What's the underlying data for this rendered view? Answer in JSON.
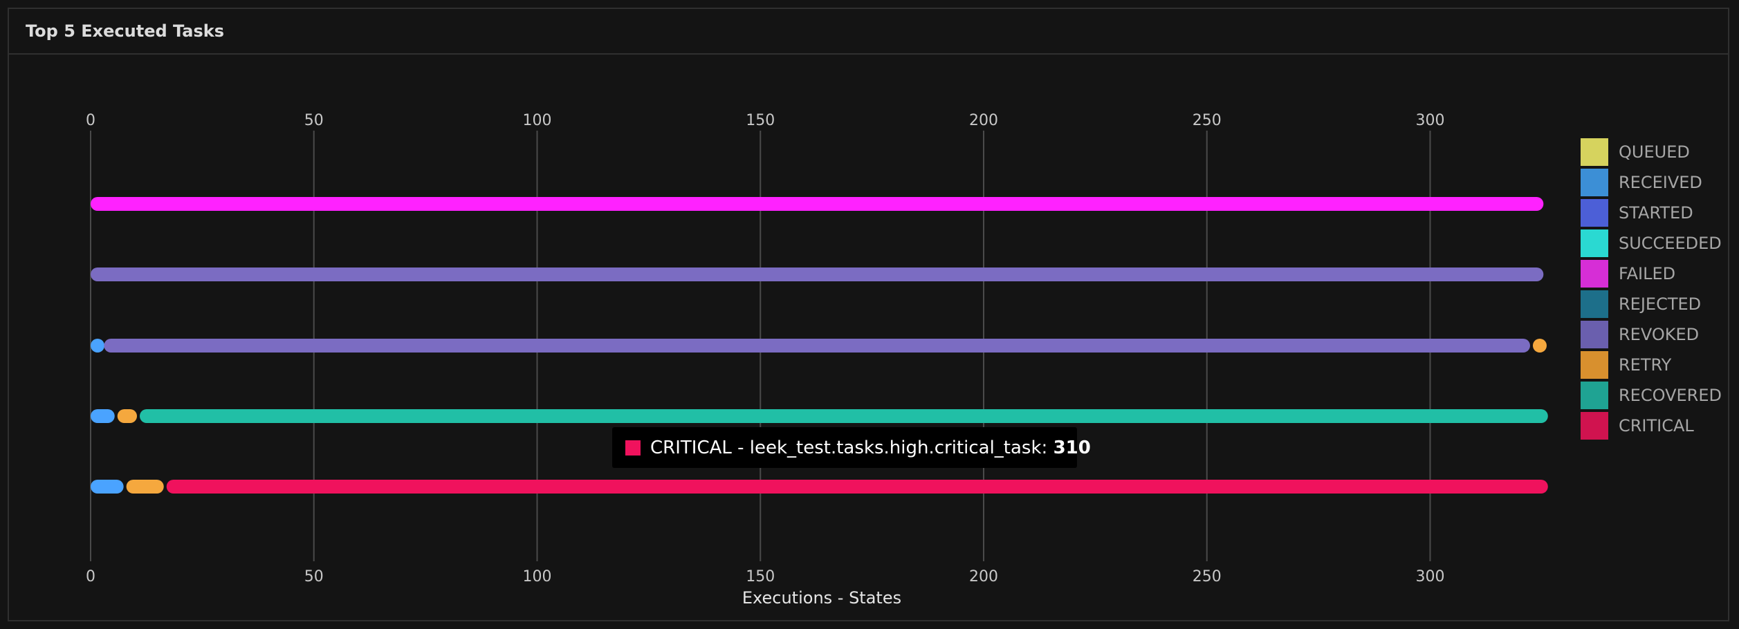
{
  "panel": {
    "title": "Top 5 Executed Tasks"
  },
  "chart_data": {
    "type": "bar",
    "orientation": "horizontal",
    "stacked": true,
    "xlabel": "Executions - States",
    "xlim": [
      0,
      327
    ],
    "xticks": [
      0,
      50,
      100,
      150,
      200,
      250,
      300
    ],
    "grid": true,
    "legend_position": "right",
    "legend": [
      {
        "name": "QUEUED",
        "color": "#d6d35e"
      },
      {
        "name": "RECEIVED",
        "color": "#3c8fd6"
      },
      {
        "name": "STARTED",
        "color": "#4c5fd7"
      },
      {
        "name": "SUCCEEDED",
        "color": "#2ad9d2"
      },
      {
        "name": "FAILED",
        "color": "#d62ed6"
      },
      {
        "name": "REJECTED",
        "color": "#1d6f8a"
      },
      {
        "name": "REVOKED",
        "color": "#6a5fae"
      },
      {
        "name": "RETRY",
        "color": "#d8902e"
      },
      {
        "name": "RECOVERED",
        "color": "#1fa393"
      },
      {
        "name": "CRITICAL",
        "color": "#d0134f"
      }
    ],
    "rows": [
      {
        "segments": [
          {
            "state": "FAILED",
            "value": 326,
            "color": "#ff22ff"
          }
        ]
      },
      {
        "segments": [
          {
            "state": "REVOKED",
            "value": 326,
            "color": "#7b6cc2"
          }
        ]
      },
      {
        "segments": [
          {
            "state": "RECEIVED",
            "value": 3,
            "color": "#4aa3ff"
          },
          {
            "state": "REVOKED",
            "value": 320,
            "color": "#7b6cc2"
          },
          {
            "state": "RETRY",
            "value": 3,
            "color": "#f5a83e"
          }
        ]
      },
      {
        "segments": [
          {
            "state": "RECEIVED",
            "value": 6,
            "color": "#4aa3ff"
          },
          {
            "state": "RETRY",
            "value": 5,
            "color": "#f5a83e"
          },
          {
            "state": "RECOVERED",
            "value": 316,
            "color": "#21bfa6"
          }
        ]
      },
      {
        "segments": [
          {
            "state": "RECEIVED",
            "value": 8,
            "color": "#4aa3ff"
          },
          {
            "state": "RETRY",
            "value": 9,
            "color": "#f5a83e"
          },
          {
            "state": "CRITICAL",
            "value": 310,
            "color": "#f0125d"
          }
        ]
      }
    ],
    "tooltip": {
      "label": "CRITICAL - leek_test.tasks.high.critical_task: ",
      "value": "310",
      "color": "#f0125d"
    }
  }
}
